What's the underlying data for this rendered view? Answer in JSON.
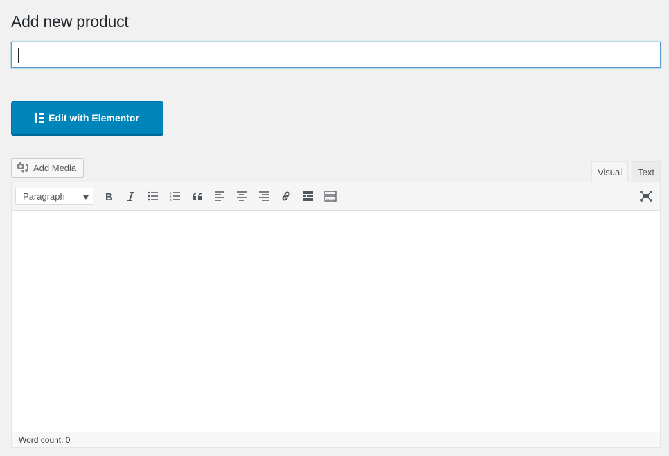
{
  "page": {
    "title": "Add new product"
  },
  "title_field": {
    "value": "",
    "placeholder": ""
  },
  "elementor_button": {
    "label": "Edit with Elementor",
    "color": "#0085ba"
  },
  "media": {
    "add_media_label": "Add Media"
  },
  "editor_tabs": [
    {
      "label": "Visual",
      "active": true
    },
    {
      "label": "Text",
      "active": false
    }
  ],
  "toolbar": {
    "format_select": {
      "selected": "Paragraph"
    },
    "buttons": [
      {
        "name": "bold",
        "icon": "bold-icon"
      },
      {
        "name": "italic",
        "icon": "italic-icon"
      },
      {
        "name": "bulleted-list",
        "icon": "bullet-list-icon"
      },
      {
        "name": "numbered-list",
        "icon": "numbered-list-icon"
      },
      {
        "name": "blockquote",
        "icon": "quote-icon"
      },
      {
        "name": "align-left",
        "icon": "align-left-icon"
      },
      {
        "name": "align-center",
        "icon": "align-center-icon"
      },
      {
        "name": "align-right",
        "icon": "align-right-icon"
      },
      {
        "name": "insert-link",
        "icon": "link-icon"
      },
      {
        "name": "read-more",
        "icon": "read-more-icon"
      },
      {
        "name": "toolbar-toggle",
        "icon": "keyboard-icon"
      }
    ],
    "fullscreen": {
      "icon": "fullscreen-icon"
    }
  },
  "status": {
    "word_count": "Word count: 0"
  }
}
